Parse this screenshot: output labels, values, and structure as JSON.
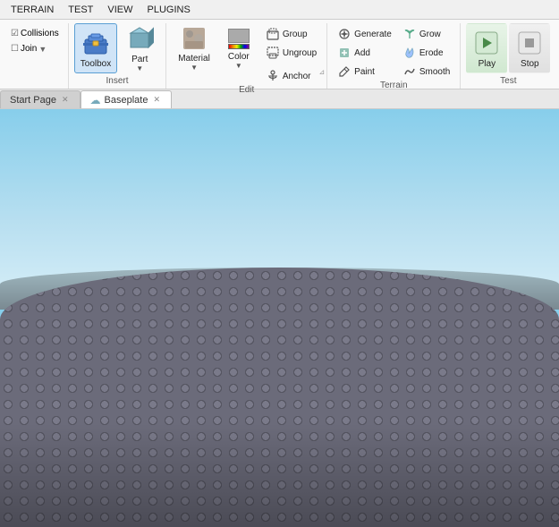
{
  "menu": {
    "items": [
      "TERRAIN",
      "TEST",
      "VIEW",
      "PLUGINS"
    ]
  },
  "ribbon": {
    "sections": [
      {
        "name": "model-section",
        "label": "",
        "buttons": [
          {
            "id": "collisions",
            "label": "Collisions",
            "type": "small-check"
          },
          {
            "id": "join",
            "label": "Join",
            "type": "small-check"
          }
        ]
      },
      {
        "name": "insert-section",
        "label": "Insert",
        "buttons": [
          {
            "id": "toolbox",
            "label": "Toolbox",
            "type": "large",
            "active": true
          },
          {
            "id": "part",
            "label": "Part",
            "type": "large"
          }
        ]
      },
      {
        "name": "edit-section",
        "label": "Edit",
        "buttons": [
          {
            "id": "material",
            "label": "Material",
            "type": "large"
          },
          {
            "id": "color",
            "label": "Color",
            "type": "large"
          },
          {
            "id": "group",
            "label": "Group",
            "type": "small"
          },
          {
            "id": "ungroup",
            "label": "Ungroup",
            "type": "small"
          },
          {
            "id": "anchor",
            "label": "Anchor",
            "type": "small"
          }
        ]
      },
      {
        "name": "terrain-section",
        "label": "Terrain",
        "buttons": [
          {
            "id": "generate",
            "label": "Generate",
            "type": "small"
          },
          {
            "id": "add",
            "label": "Add",
            "type": "small"
          },
          {
            "id": "paint",
            "label": "Paint",
            "type": "small"
          },
          {
            "id": "grow",
            "label": "Grow",
            "type": "small"
          },
          {
            "id": "erode",
            "label": "Erode",
            "type": "small"
          },
          {
            "id": "smooth",
            "label": "Smooth",
            "type": "small"
          }
        ]
      },
      {
        "name": "test-section",
        "label": "Test",
        "buttons": [
          {
            "id": "play",
            "label": "Play",
            "type": "large"
          },
          {
            "id": "stop",
            "label": "Stop",
            "type": "large"
          }
        ]
      }
    ]
  },
  "tabs": [
    {
      "id": "start-page",
      "label": "Start Page",
      "closeable": true,
      "active": false,
      "icon": ""
    },
    {
      "id": "baseplate",
      "label": "Baseplate",
      "closeable": true,
      "active": true,
      "icon": "cloud"
    }
  ],
  "viewport": {
    "background": "3d-terrain"
  },
  "icons": {
    "toolbox": "🧰",
    "part": "🟦",
    "material": "🪨",
    "color": "🎨",
    "group": "📦",
    "ungroup": "📤",
    "anchor": "⚓",
    "generate": "⚙️",
    "add": "➕",
    "paint": "🖌️",
    "grow": "🌱",
    "erode": "💧",
    "smooth": "〰️",
    "play": "▶",
    "stop": "⏹",
    "collisions": "🔲",
    "join": "🔗",
    "check": "✓",
    "cloud": "☁"
  },
  "colors": {
    "ribbon_bg": "#f9f9f9",
    "active_tab": "#ffffff",
    "sky_top": "#87ceeb",
    "terrain": "#6b6b7a",
    "accent": "#5a9fd4"
  }
}
